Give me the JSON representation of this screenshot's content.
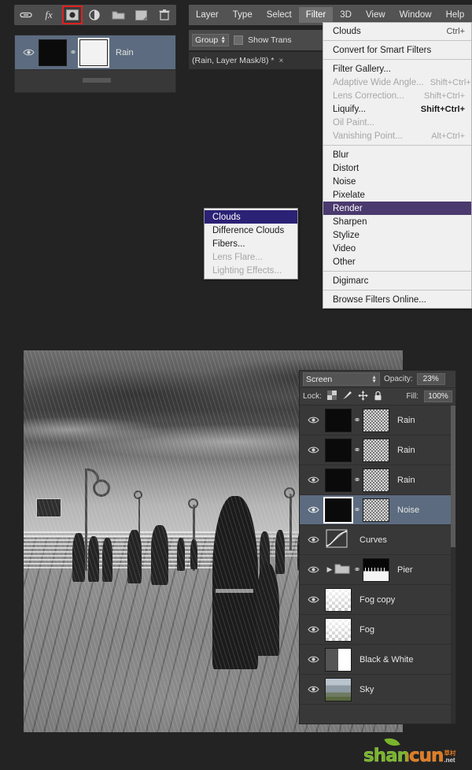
{
  "layer_toolbar": {
    "items": [
      {
        "name": "link-layers-icon",
        "label": "link"
      },
      {
        "name": "fx-icon",
        "label": "fx"
      },
      {
        "name": "add-layer-mask-icon",
        "label": "mask",
        "selected": true
      },
      {
        "name": "new-fill-adjustment-icon",
        "label": "adjustment"
      },
      {
        "name": "new-group-icon",
        "label": "group"
      },
      {
        "name": "new-layer-icon",
        "label": "new"
      },
      {
        "name": "delete-layer-icon",
        "label": "delete"
      }
    ]
  },
  "mini_layers": {
    "rows": [
      {
        "name": "Rain",
        "selected": true,
        "mask": "white"
      }
    ]
  },
  "menubar": {
    "items": [
      {
        "label": "Layer",
        "open": false
      },
      {
        "label": "Type",
        "open": false
      },
      {
        "label": "Select",
        "open": false
      },
      {
        "label": "Filter",
        "open": true
      },
      {
        "label": "3D",
        "open": false
      },
      {
        "label": "View",
        "open": false
      },
      {
        "label": "Window",
        "open": false
      },
      {
        "label": "Help",
        "open": false
      }
    ]
  },
  "options_bar": {
    "group_label": "Group",
    "show_transform_label": "Show Trans",
    "tab_title": "(Rain, Layer Mask/8) *",
    "tab_close": "×"
  },
  "filter_menu": {
    "groups": [
      {
        "items": [
          {
            "label": "Clouds",
            "accel": "Ctrl+",
            "disabled": false
          }
        ]
      },
      {
        "items": [
          {
            "label": "Convert for Smart Filters",
            "accel": "",
            "disabled": false
          }
        ]
      },
      {
        "items": [
          {
            "label": "Filter Gallery...",
            "accel": "",
            "disabled": false,
            "underline": "G"
          },
          {
            "label": "Adaptive Wide Angle...",
            "accel": "Shift+Ctrl+",
            "disabled": true
          },
          {
            "label": "Lens Correction...",
            "accel": "Shift+Ctrl+",
            "disabled": true
          },
          {
            "label": "Liquify...",
            "accel": "Shift+Ctrl+",
            "disabled": false,
            "underline": "L"
          },
          {
            "label": "Oil Paint...",
            "accel": "",
            "disabled": true
          },
          {
            "label": "Vanishing Point...",
            "accel": "Alt+Ctrl+",
            "disabled": true
          }
        ]
      },
      {
        "items": [
          {
            "label": "Blur",
            "accel": "",
            "disabled": false
          },
          {
            "label": "Distort",
            "accel": "",
            "disabled": false
          },
          {
            "label": "Noise",
            "accel": "",
            "disabled": false
          },
          {
            "label": "Pixelate",
            "accel": "",
            "disabled": false
          },
          {
            "label": "Render",
            "accel": "",
            "disabled": false,
            "highlighted": true
          },
          {
            "label": "Sharpen",
            "accel": "",
            "disabled": false
          },
          {
            "label": "Stylize",
            "accel": "",
            "disabled": false
          },
          {
            "label": "Video",
            "accel": "",
            "disabled": false
          },
          {
            "label": "Other",
            "accel": "",
            "disabled": false
          }
        ]
      },
      {
        "items": [
          {
            "label": "Digimarc",
            "accel": "",
            "disabled": false
          }
        ]
      },
      {
        "items": [
          {
            "label": "Browse Filters Online...",
            "accel": "",
            "disabled": false
          }
        ]
      }
    ]
  },
  "render_submenu": {
    "items": [
      {
        "label": "Clouds",
        "highlighted": true,
        "disabled": false
      },
      {
        "label": "Difference Clouds",
        "highlighted": false,
        "disabled": false
      },
      {
        "label": "Fibers...",
        "highlighted": false,
        "disabled": false
      },
      {
        "label": "Lens Flare...",
        "highlighted": false,
        "disabled": true
      },
      {
        "label": "Lighting Effects...",
        "highlighted": false,
        "disabled": true
      }
    ]
  },
  "layers_panel": {
    "blend_mode": "Screen",
    "opacity_label": "Opacity:",
    "opacity_value": "23%",
    "lock_label": "Lock:",
    "fill_label": "Fill:",
    "fill_value": "100%",
    "lock_icons": [
      {
        "name": "lock-transparent-pixels-icon"
      },
      {
        "name": "lock-image-pixels-icon"
      },
      {
        "name": "lock-position-icon"
      },
      {
        "name": "lock-all-icon"
      }
    ],
    "rows": [
      {
        "name": "Rain",
        "thumb": "black",
        "mask": "noise",
        "link": true,
        "selected": false,
        "visible": true,
        "kind": "layer"
      },
      {
        "name": "Rain",
        "thumb": "black",
        "mask": "noise",
        "link": true,
        "selected": false,
        "visible": true,
        "kind": "layer"
      },
      {
        "name": "Rain",
        "thumb": "black",
        "mask": "noise",
        "link": true,
        "selected": false,
        "visible": true,
        "kind": "layer"
      },
      {
        "name": "Noise",
        "thumb": "black",
        "mask": "noise",
        "link": true,
        "selected": true,
        "visible": true,
        "kind": "layer"
      },
      {
        "name": "Curves",
        "thumb": "curves",
        "mask": "",
        "link": false,
        "selected": false,
        "visible": true,
        "kind": "adjustment"
      },
      {
        "name": "Pier",
        "thumb": "folder",
        "mask": "pier",
        "link": true,
        "selected": false,
        "visible": true,
        "kind": "group"
      },
      {
        "name": "Fog copy",
        "thumb": "checker",
        "mask": "",
        "link": false,
        "selected": false,
        "visible": true,
        "kind": "layer"
      },
      {
        "name": "Fog",
        "thumb": "checker",
        "mask": "",
        "link": false,
        "selected": false,
        "visible": true,
        "kind": "layer"
      },
      {
        "name": "Black & White",
        "thumb": "bw",
        "mask": "",
        "link": false,
        "selected": false,
        "visible": true,
        "kind": "adjustment"
      },
      {
        "name": "Sky",
        "thumb": "sky",
        "mask": "",
        "link": false,
        "selected": false,
        "visible": true,
        "kind": "layer"
      }
    ]
  },
  "watermark": {
    "main": "shancun",
    "cn": "草村",
    "net": ".net"
  },
  "colors": {
    "panel_bg": "#383838",
    "menu_bg": "#f0f0f0",
    "render_highlight": "#4a3a6e",
    "clouds_highlight": "#2b2175",
    "selected_row": "#5c6b7f",
    "mask_button_outline": "#e02020"
  }
}
